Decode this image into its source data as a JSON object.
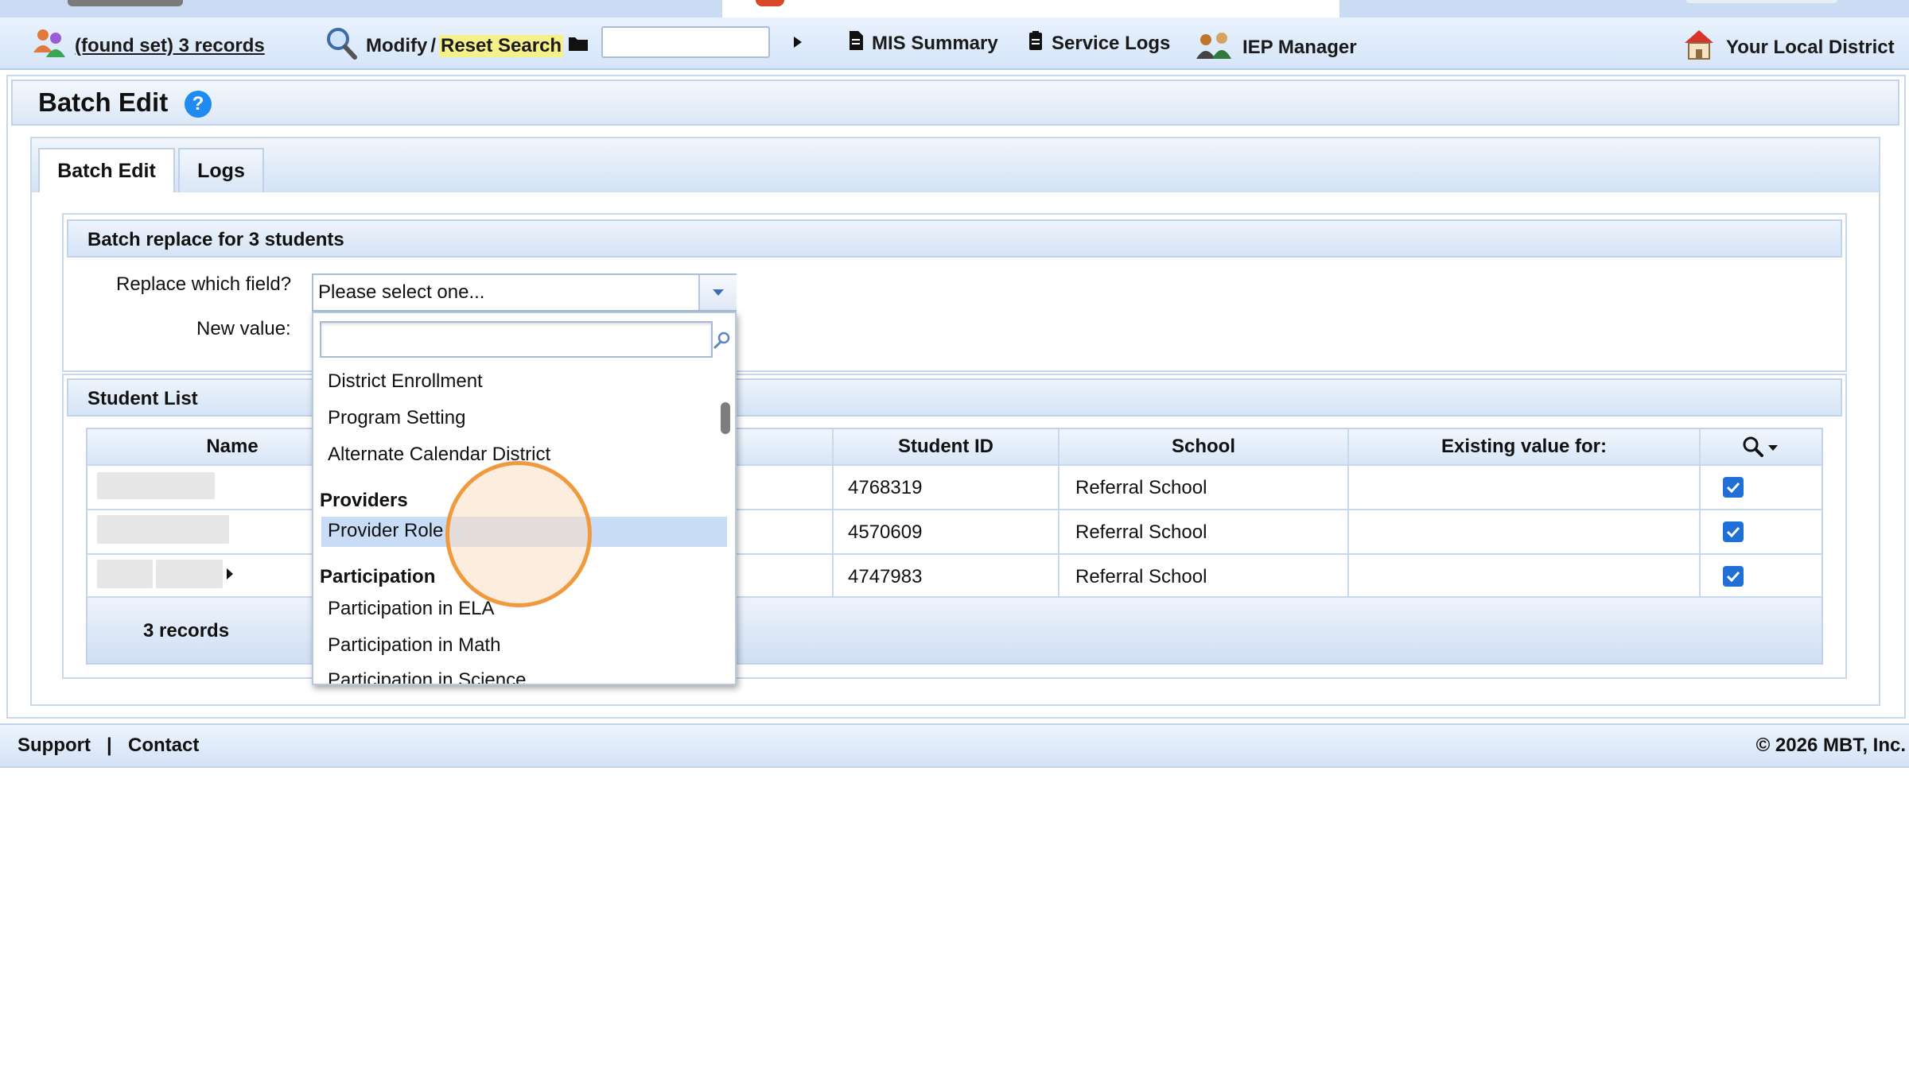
{
  "toolbar": {
    "found_set": "(found set) 3 records",
    "modify_label": "Modify",
    "separator": "/",
    "reset_search_label": "Reset Search",
    "mis_summary_label": "MIS Summary",
    "service_logs_label": "Service Logs",
    "iep_manager_label": "IEP Manager",
    "district_label": "Your Local District"
  },
  "panel": {
    "title": "Batch Edit",
    "help_glyph": "?",
    "tabs": [
      {
        "label": "Batch Edit",
        "active": true
      },
      {
        "label": "Logs",
        "active": false
      }
    ]
  },
  "batch_replace": {
    "title": "Batch replace for 3 students",
    "replace_label": "Replace which field?",
    "new_value_label": "New value:",
    "select_value": "Please select one..."
  },
  "dropdown": {
    "search_value": "",
    "items_top": [
      "District Enrollment",
      "Program Setting",
      "Alternate Calendar District"
    ],
    "group_providers": "Providers",
    "providers_items": [
      "Provider Role"
    ],
    "group_participation": "Participation",
    "participation_items": [
      "Participation in ELA",
      "Participation in Math",
      "Participation in Science"
    ],
    "highlighted_item": "Provider Role"
  },
  "student_list": {
    "title": "Student List",
    "columns": [
      "Name",
      "Student ID",
      "School",
      "Existing value for:"
    ],
    "rows": [
      {
        "student_id": "4768319",
        "school": "Referral School",
        "existing_value": "",
        "checked": true
      },
      {
        "student_id": "4570609",
        "school": "Referral School",
        "existing_value": "",
        "checked": true
      },
      {
        "student_id": "4747983",
        "school": "Referral School",
        "existing_value": "",
        "checked": true
      }
    ],
    "records_label": "3 records"
  },
  "footer": {
    "support_label": "Support",
    "divider": "|",
    "contact_label": "Contact",
    "copyright": "© 2026 MBT, Inc."
  },
  "icons": [
    "people-icon",
    "magnifier-icon",
    "folder-icon",
    "play-icon",
    "document-icon",
    "clipboard-icon",
    "iep-people-icon",
    "district-house-icon",
    "help-icon",
    "chevron-down-icon",
    "search-icon",
    "checkbox-icon"
  ],
  "colors": {
    "accent": "#1f8bf0",
    "highlight": "#f5f08a",
    "toolbar_bg": "#d5e5f8",
    "hover_row": "#c9dcf6",
    "click_ring": "#ef9a3c"
  }
}
